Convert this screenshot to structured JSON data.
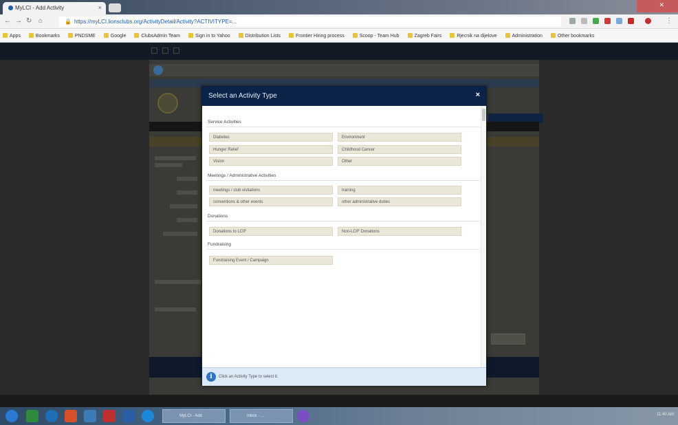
{
  "browser": {
    "tab_title": "MyLCI - Add Activity",
    "address": "https://myLCI.lionsclubs.org/ActivityDetail/Activity?ACTIVITYPE=...",
    "bookmarks": [
      "Apps",
      "Bookmarks",
      "PNDSME",
      "Google",
      "ClubsAdmin Team",
      "Sign in to Yahoo",
      "Distribution Lists",
      "Frontier Hiring process",
      "Scoop - Team Hub",
      "Zagreb Fairs",
      "Rjecnik na dijelove",
      "Administration",
      "Other bookmarks"
    ]
  },
  "modal": {
    "title": "Select an Activity Type",
    "close_label": "×",
    "sections": [
      {
        "title": "Service Activities",
        "items": [
          "Diabetes",
          "Environment",
          "Hunger Relief",
          "Childhood Cancer",
          "Vision",
          "Other"
        ]
      },
      {
        "title": "Meetings / Administrative Activities",
        "items": [
          "meetings / club visitations",
          "training",
          "conventions & other events",
          "other administrative duties"
        ]
      },
      {
        "title": "Donations",
        "items": [
          "Donations to LCIF",
          "Non-LCIF Donations"
        ]
      },
      {
        "title": "Fundraising",
        "items": [
          "Fundraising Event / Campaign"
        ]
      }
    ],
    "footer_text": "Click an Activity Type to select it."
  },
  "taskbar": {
    "items": [
      "MyLCI - Add",
      "Inbox - ..."
    ],
    "clock": "11:40 AM"
  },
  "colors": {
    "modal_header": "#0b2249",
    "button_bg": "#eae6d8",
    "footer_bg": "#dce9f7"
  }
}
